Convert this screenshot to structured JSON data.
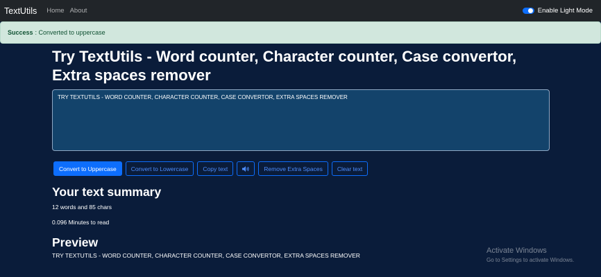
{
  "navbar": {
    "brand": "TextUtils",
    "links": [
      "Home",
      "About"
    ],
    "mode_toggle_label": "Enable Light Mode",
    "mode_toggle_on": true
  },
  "alert": {
    "type": "Success",
    "strong": "Success",
    "message": ": Converted to uppercase"
  },
  "main": {
    "heading": "Try TextUtils - Word counter, Character counter, Case convertor, Extra spaces remover",
    "textarea_value": "TRY TEXTUTILS - WORD COUNTER, CHARACTER COUNTER, CASE CONVERTOR, EXTRA SPACES REMOVER",
    "buttons": {
      "uppercase": "Convert to Uppercase",
      "lowercase": "Convert to Lowercase",
      "copy": "Copy text",
      "speak_icon": "speaker-icon",
      "remove_spaces": "Remove Extra Spaces",
      "clear": "Clear text"
    }
  },
  "summary": {
    "heading": "Your text summary",
    "counts": "12 words and 85 chars",
    "read_time": "0.096 Minutes to read"
  },
  "preview": {
    "heading": "Preview",
    "text": "TRY TEXTUTILS - WORD COUNTER, CHARACTER COUNTER, CASE CONVERTOR, EXTRA SPACES REMOVER"
  },
  "watermark": {
    "title": "Activate Windows",
    "subtitle": "Go to Settings to activate Windows."
  },
  "colors": {
    "background": "#0a1c3a",
    "navbar": "#212529",
    "accent": "#0d6efd",
    "textarea_bg": "#13436b",
    "alert_bg": "#d1e7dd",
    "alert_text": "#0f5132"
  }
}
